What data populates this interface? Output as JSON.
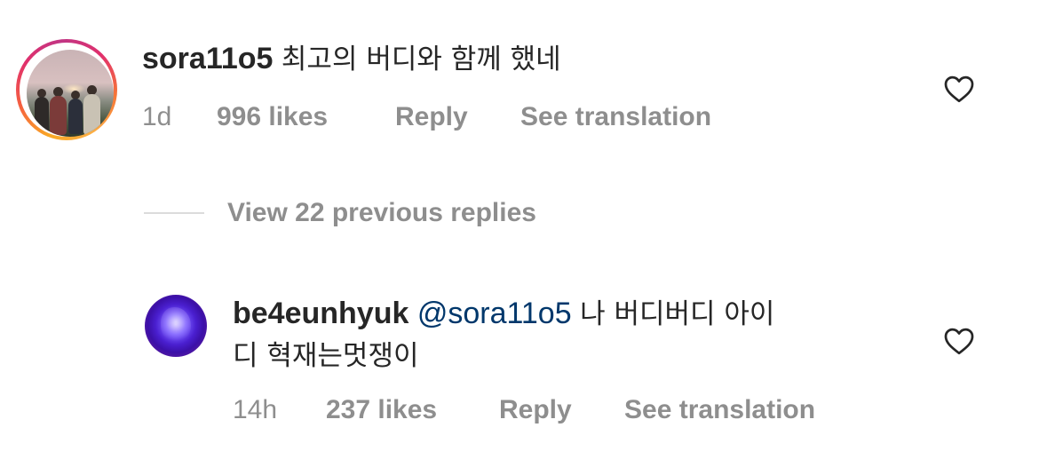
{
  "comment": {
    "username": "sora11o5",
    "text": "최고의 버디와 함께 했네",
    "time": "1d",
    "likes": "996 likes",
    "reply_label": "Reply",
    "translate_label": "See translation",
    "like_icon": "heart-outline-icon"
  },
  "view_replies": {
    "label": "View 22 previous replies"
  },
  "reply": {
    "username": "be4eunhyuk",
    "mention": "@sora11o5",
    "text_line1": "나 버디버디 아이",
    "text_line2": "디 혁재는멋쟁이",
    "time": "14h",
    "likes": "237 likes",
    "reply_label": "Reply",
    "translate_label": "See translation",
    "like_icon": "heart-outline-icon"
  },
  "colors": {
    "text": "#262626",
    "secondary": "#8e8e8e",
    "mention": "#00376b",
    "divider": "#dbdbdb"
  }
}
